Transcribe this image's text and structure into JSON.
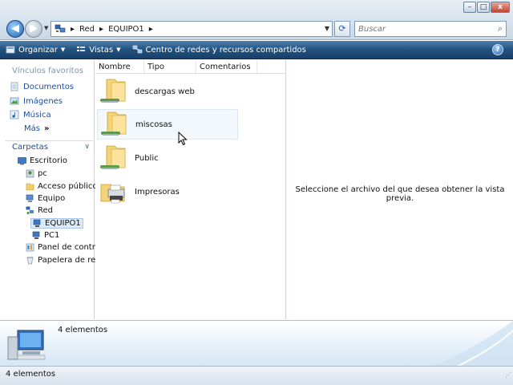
{
  "window": {
    "minimize": "–",
    "maximize": "□",
    "close": "x"
  },
  "address": {
    "segments": [
      "Red",
      "EQUIPO1"
    ],
    "separator": "▸"
  },
  "search": {
    "placeholder": "Buscar"
  },
  "toolbar": {
    "organize": "Organizar",
    "views": "Vistas",
    "network_center": "Centro de redes y recursos compartidos",
    "help": "?"
  },
  "navpane": {
    "favorites_heading": "Vínculos favoritos",
    "favorites": [
      "Documentos",
      "Imágenes",
      "Música"
    ],
    "more": "Más",
    "more_glyph": "»",
    "folders_heading": "Carpetas",
    "tree": [
      "Escritorio",
      "pc",
      "Acceso público",
      "Equipo",
      "Red",
      "EQUIPO1",
      "PC1",
      "Panel de contro",
      "Papelera de reci"
    ]
  },
  "columns": [
    "Nombre",
    "Tipo",
    "Comentarios"
  ],
  "files": [
    "descargas web",
    "miscosas",
    "Public",
    "Impresoras"
  ],
  "preview": {
    "message": "Seleccione el archivo del que desea obtener la vista previa."
  },
  "details": {
    "count": "4 elementos"
  },
  "status": {
    "text": "4 elementos"
  },
  "colors": {
    "toolbar": "#22517e",
    "link": "#1e4fa0",
    "heading": "#8096ad",
    "selection": "#dce9f7"
  }
}
